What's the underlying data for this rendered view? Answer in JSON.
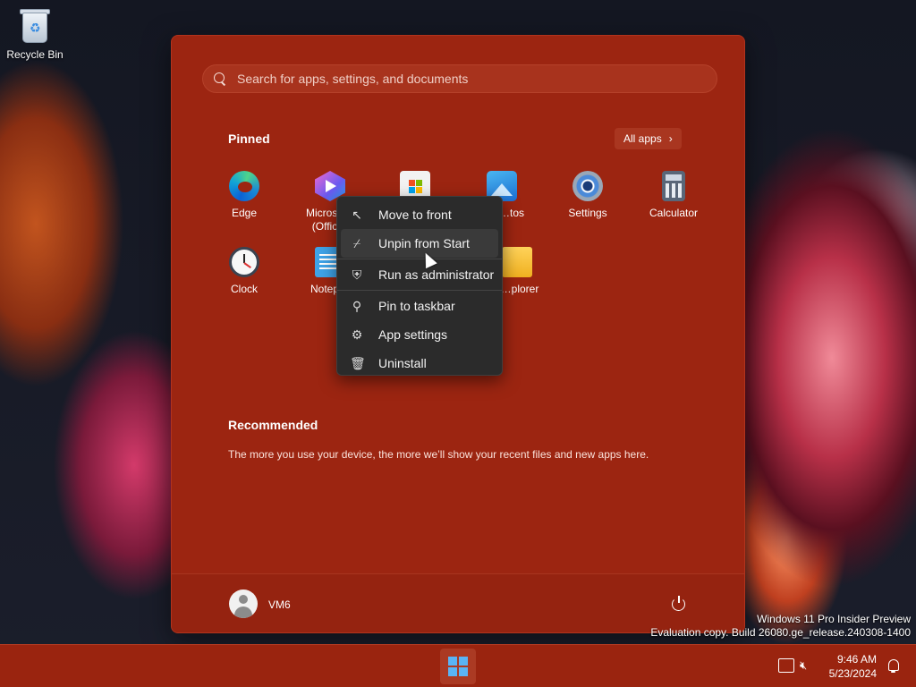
{
  "desktop": {
    "recycle_bin_label": "Recycle Bin"
  },
  "start_menu": {
    "search_placeholder": "Search for apps, settings, and documents",
    "pinned_title": "Pinned",
    "all_apps_label": "All apps",
    "pinned_apps": [
      {
        "name": "Edge",
        "icon": "edge-icon"
      },
      {
        "name": "Microso… (Offic…",
        "icon": "copilot-icon"
      },
      {
        "name": "",
        "icon": "store-icon"
      },
      {
        "name": "…tos",
        "icon": "photos-icon"
      },
      {
        "name": "Settings",
        "icon": "settings-icon"
      },
      {
        "name": "Calculator",
        "icon": "calculator-icon"
      },
      {
        "name": "Clock",
        "icon": "clock-icon"
      },
      {
        "name": "Notep…",
        "icon": "notepad-icon"
      },
      {
        "name": "…plorer",
        "icon": "file-explorer-icon"
      }
    ],
    "recommended_title": "Recommended",
    "recommended_text": "The more you use your device, the more we’ll show your recent files and new apps here.",
    "user_name": "VM6"
  },
  "context_menu": {
    "items": [
      {
        "label": "Move to front",
        "icon": "arrow-up-left-icon"
      },
      {
        "label": "Unpin from Start",
        "icon": "unpin-icon"
      },
      {
        "label": "Run as administrator",
        "icon": "shield-icon"
      },
      {
        "label": "Pin to taskbar",
        "icon": "pin-icon"
      },
      {
        "label": "App settings",
        "icon": "gear-icon"
      },
      {
        "label": "Uninstall",
        "icon": "trash-icon"
      }
    ]
  },
  "watermark": {
    "line1": "Windows 11 Pro Insider Preview",
    "line2": "Evaluation copy. Build 26080.ge_release.240308-1400"
  },
  "taskbar": {
    "time": "9:46 AM",
    "date": "5/23/2024"
  },
  "colors": {
    "start_bg": "#9c2511",
    "taskbar_bg": "#9a240f",
    "menu_bg": "#2b2b2b",
    "accent_blue": "#5ab4f5"
  }
}
